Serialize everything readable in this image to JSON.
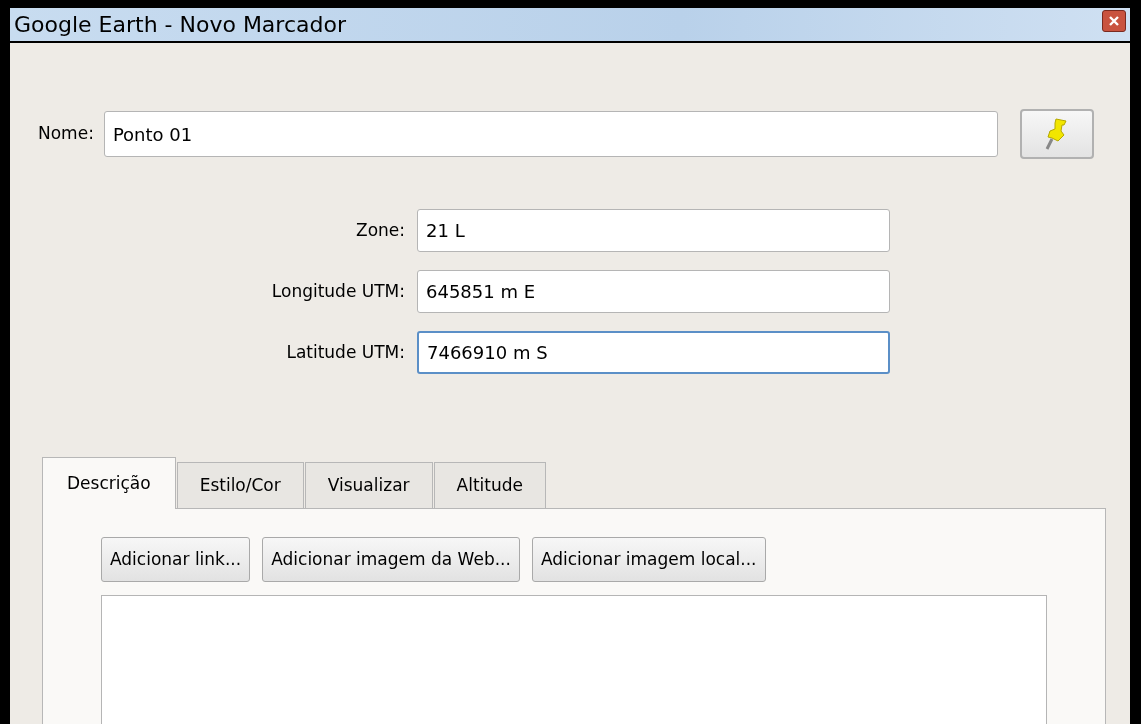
{
  "window": {
    "title": "Google Earth - Novo Marcador"
  },
  "name_field": {
    "label": "Nome:",
    "value": "Ponto 01"
  },
  "coordinates": [
    {
      "label": "Zone:",
      "value": "21 L",
      "focused": false
    },
    {
      "label": "Longitude UTM:",
      "value": "645851 m E",
      "focused": false
    },
    {
      "label": "Latitude UTM:",
      "value": "7466910 m S",
      "focused": true
    }
  ],
  "tabs": [
    {
      "label": "Descrição",
      "selected": true
    },
    {
      "label": "Estilo/Cor",
      "selected": false
    },
    {
      "label": "Visualizar",
      "selected": false
    },
    {
      "label": "Altitude",
      "selected": false
    }
  ],
  "description_buttons": [
    "Adicionar link...",
    "Adicionar imagem da Web...",
    "Adicionar imagem local..."
  ]
}
